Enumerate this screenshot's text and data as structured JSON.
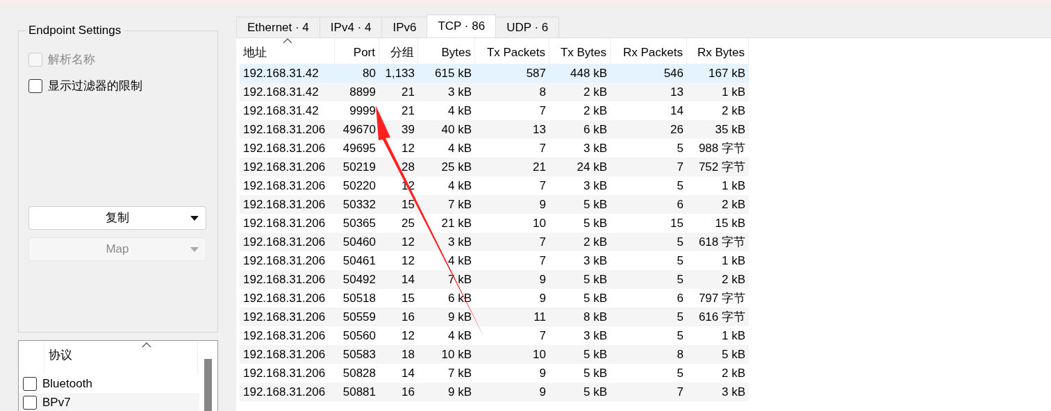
{
  "endpoint_settings": {
    "title": "Endpoint Settings",
    "options": [
      {
        "label": "解析名称",
        "checked": false,
        "disabled": true
      },
      {
        "label": "显示过滤器的限制",
        "checked": false,
        "disabled": false
      }
    ],
    "buttons": [
      {
        "label": "复制",
        "disabled": false
      },
      {
        "label": "Map",
        "disabled": true
      }
    ]
  },
  "protocol_list": {
    "column": "协议",
    "sorted": true,
    "items": [
      {
        "label": "Bluetooth",
        "checked": false
      },
      {
        "label": "BPv7",
        "checked": false
      }
    ]
  },
  "tabs": [
    {
      "label": "Ethernet · 4",
      "selected": false
    },
    {
      "label": "IPv4 · 4",
      "selected": false
    },
    {
      "label": "IPv6",
      "selected": false
    },
    {
      "label": "TCP · 86",
      "selected": true
    },
    {
      "label": "UDP · 6",
      "selected": false
    }
  ],
  "table": {
    "columns": [
      {
        "label": "地址",
        "sorted": true
      },
      {
        "label": "Port",
        "sorted": false
      },
      {
        "label": "分组",
        "sorted": false
      },
      {
        "label": "Bytes",
        "sorted": false
      },
      {
        "label": "Tx Packets",
        "sorted": false
      },
      {
        "label": "Tx Bytes",
        "sorted": false
      },
      {
        "label": "Rx Packets",
        "sorted": false
      },
      {
        "label": "Rx Bytes",
        "sorted": false
      }
    ],
    "rows": [
      {
        "selected": true,
        "cells": [
          "192.168.31.42",
          "80",
          "1,133",
          "615 kB",
          "587",
          "448 kB",
          "546",
          "167 kB"
        ]
      },
      {
        "selected": false,
        "cells": [
          "192.168.31.42",
          "8899",
          "21",
          "3 kB",
          "8",
          "2 kB",
          "13",
          "1 kB"
        ]
      },
      {
        "selected": false,
        "cells": [
          "192.168.31.42",
          "9999",
          "21",
          "4 kB",
          "7",
          "2 kB",
          "14",
          "2 kB"
        ]
      },
      {
        "selected": false,
        "cells": [
          "192.168.31.206",
          "49670",
          "39",
          "40 kB",
          "13",
          "6 kB",
          "26",
          "35 kB"
        ]
      },
      {
        "selected": false,
        "cells": [
          "192.168.31.206",
          "49695",
          "12",
          "4 kB",
          "7",
          "3 kB",
          "5",
          "988 字节"
        ]
      },
      {
        "selected": false,
        "cells": [
          "192.168.31.206",
          "50219",
          "28",
          "25 kB",
          "21",
          "24 kB",
          "7",
          "752 字节"
        ]
      },
      {
        "selected": false,
        "cells": [
          "192.168.31.206",
          "50220",
          "12",
          "4 kB",
          "7",
          "3 kB",
          "5",
          "1 kB"
        ]
      },
      {
        "selected": false,
        "cells": [
          "192.168.31.206",
          "50332",
          "15",
          "7 kB",
          "9",
          "5 kB",
          "6",
          "2 kB"
        ]
      },
      {
        "selected": false,
        "cells": [
          "192.168.31.206",
          "50365",
          "25",
          "21 kB",
          "10",
          "5 kB",
          "15",
          "15 kB"
        ]
      },
      {
        "selected": false,
        "cells": [
          "192.168.31.206",
          "50460",
          "12",
          "3 kB",
          "7",
          "2 kB",
          "5",
          "618 字节"
        ]
      },
      {
        "selected": false,
        "cells": [
          "192.168.31.206",
          "50461",
          "12",
          "4 kB",
          "7",
          "3 kB",
          "5",
          "1 kB"
        ]
      },
      {
        "selected": false,
        "cells": [
          "192.168.31.206",
          "50492",
          "14",
          "7 kB",
          "9",
          "5 kB",
          "5",
          "2 kB"
        ]
      },
      {
        "selected": false,
        "cells": [
          "192.168.31.206",
          "50518",
          "15",
          "6 kB",
          "9",
          "5 kB",
          "6",
          "797 字节"
        ]
      },
      {
        "selected": false,
        "cells": [
          "192.168.31.206",
          "50559",
          "16",
          "9 kB",
          "11",
          "8 kB",
          "5",
          "616 字节"
        ]
      },
      {
        "selected": false,
        "cells": [
          "192.168.31.206",
          "50560",
          "12",
          "4 kB",
          "7",
          "3 kB",
          "5",
          "1 kB"
        ]
      },
      {
        "selected": false,
        "cells": [
          "192.168.31.206",
          "50583",
          "18",
          "10 kB",
          "10",
          "5 kB",
          "8",
          "5 kB"
        ]
      },
      {
        "selected": false,
        "cells": [
          "192.168.31.206",
          "50828",
          "14",
          "7 kB",
          "9",
          "5 kB",
          "5",
          "2 kB"
        ]
      },
      {
        "selected": false,
        "cells": [
          "192.168.31.206",
          "50881",
          "16",
          "9 kB",
          "9",
          "5 kB",
          "7",
          "3 kB"
        ]
      }
    ]
  },
  "annotations": [
    {
      "kind": "arrow",
      "color": "#ff2020"
    }
  ]
}
